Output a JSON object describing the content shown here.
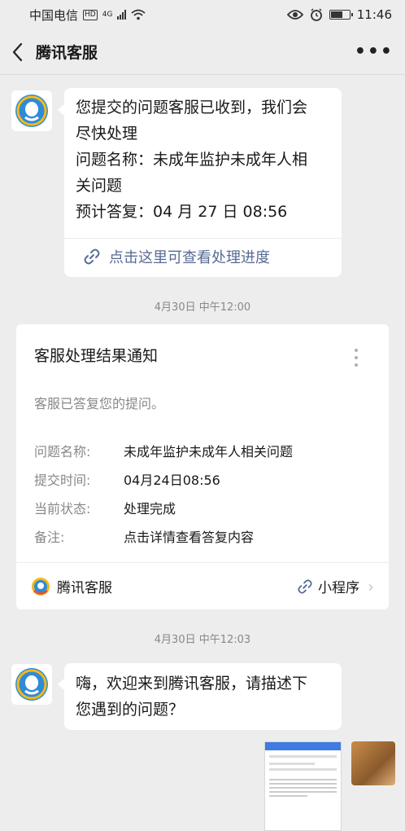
{
  "status_bar": {
    "carrier": "中国电信",
    "hd": "HD",
    "network": "4G",
    "time": "11:46",
    "icons": [
      "hd-icon",
      "signal-icon",
      "wifi-icon",
      "eye-icon",
      "alarm-icon",
      "battery-icon"
    ],
    "battery_level": 0.7
  },
  "nav": {
    "title": "腾讯客服",
    "back_icon": "chevron-left-icon",
    "more_label": "•••"
  },
  "messages": {
    "first": {
      "lines": [
        "您提交的问题客服已收到，我们会",
        "尽快处理",
        "问题名称：未成年监护未成年人相",
        "关问题",
        "预计答复：04 月 27 日 08:56"
      ],
      "link_label": "点击这里可查看处理进度",
      "link_icon": "link-icon"
    },
    "timestamp1": "4月30日 中午12:00",
    "card": {
      "title": "客服处理结果通知",
      "subtitle": "客服已答复您的提问。",
      "rows": [
        {
          "key": "问题名称:",
          "value": "未成年监护未成年人相关问题"
        },
        {
          "key": "提交时间:",
          "value": "04月24日08:56"
        },
        {
          "key": "当前状态:",
          "value": "处理完成"
        },
        {
          "key": "备注:",
          "value": "点击详情查看答复内容"
        }
      ],
      "footer_app": "腾讯客服",
      "footer_mini": "小程序",
      "footer_mini_icon": "mini-program-icon"
    },
    "timestamp2": "4月30日 中午12:03",
    "second": {
      "lines": [
        "嗨，欢迎来到腾讯客服，请描述下",
        "您遇到的问题？"
      ]
    }
  },
  "colors": {
    "background": "#ededed",
    "bubble": "#ffffff",
    "link": "#576b95",
    "brand_blue": "#2e8bd8",
    "brand_yellow": "#f5b817"
  }
}
